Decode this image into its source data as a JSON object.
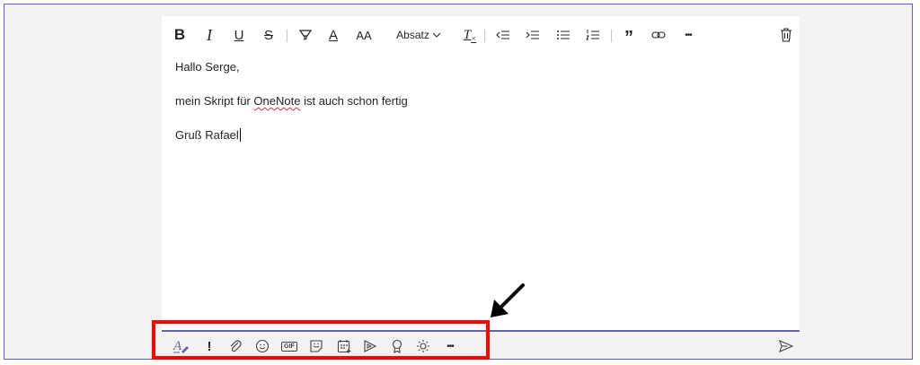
{
  "format_toolbar": {
    "items": [
      {
        "name": "bold",
        "icon": "bold-icon",
        "glyph": "B"
      },
      {
        "name": "italic",
        "icon": "italic-icon",
        "glyph": "I"
      },
      {
        "name": "underline",
        "icon": "underline-icon",
        "glyph": "U"
      },
      {
        "name": "strikethrough",
        "icon": "strikethrough-icon",
        "glyph": "S"
      },
      {
        "name": "highlight",
        "icon": "highlighter-icon"
      },
      {
        "name": "font-color",
        "icon": "font-color-icon",
        "glyph": "A"
      },
      {
        "name": "font-size",
        "icon": "font-size-icon",
        "glyph": "AA"
      },
      {
        "name": "paragraph",
        "label": "Absatz",
        "icon": "chevron-down-icon"
      },
      {
        "name": "clear-formatting",
        "icon": "clear-formatting-icon",
        "glyph": "T"
      },
      {
        "name": "decrease-indent",
        "icon": "decrease-indent-icon"
      },
      {
        "name": "increase-indent",
        "icon": "increase-indent-icon"
      },
      {
        "name": "bulleted-list",
        "icon": "bulleted-list-icon"
      },
      {
        "name": "numbered-list",
        "icon": "numbered-list-icon"
      },
      {
        "name": "quote",
        "icon": "quote-icon",
        "glyph": "”"
      },
      {
        "name": "link",
        "icon": "link-icon"
      },
      {
        "name": "more-options",
        "icon": "more-icon",
        "glyph": "•••"
      },
      {
        "name": "delete",
        "icon": "trash-icon"
      }
    ]
  },
  "message": {
    "line1": "Hallo Serge,",
    "line2_before": "mein Skript für ",
    "line2_misspelled": "OneNote",
    "line2_after": " ist auch schon fertig",
    "line3": "Gruß Rafael"
  },
  "bottom_toolbar": {
    "items": [
      {
        "name": "format",
        "icon": "format-icon",
        "glyph": "A"
      },
      {
        "name": "important",
        "icon": "exclamation-icon",
        "glyph": "!"
      },
      {
        "name": "attach",
        "icon": "paperclip-icon"
      },
      {
        "name": "emoji",
        "icon": "emoji-icon"
      },
      {
        "name": "gif",
        "icon": "gif-icon",
        "glyph": "GIF"
      },
      {
        "name": "sticker",
        "icon": "sticker-icon"
      },
      {
        "name": "schedule-meeting",
        "icon": "calendar-icon"
      },
      {
        "name": "stream",
        "icon": "stream-icon"
      },
      {
        "name": "praise",
        "icon": "praise-icon"
      },
      {
        "name": "app",
        "icon": "sun-icon"
      },
      {
        "name": "more",
        "icon": "more-icon",
        "glyph": "•••"
      },
      {
        "name": "send",
        "icon": "send-icon"
      }
    ]
  },
  "colors": {
    "accent": "#6264a7",
    "highlight_box": "#ff0000",
    "spellcheck": "#c4314b",
    "background": "#f3f2f1"
  }
}
